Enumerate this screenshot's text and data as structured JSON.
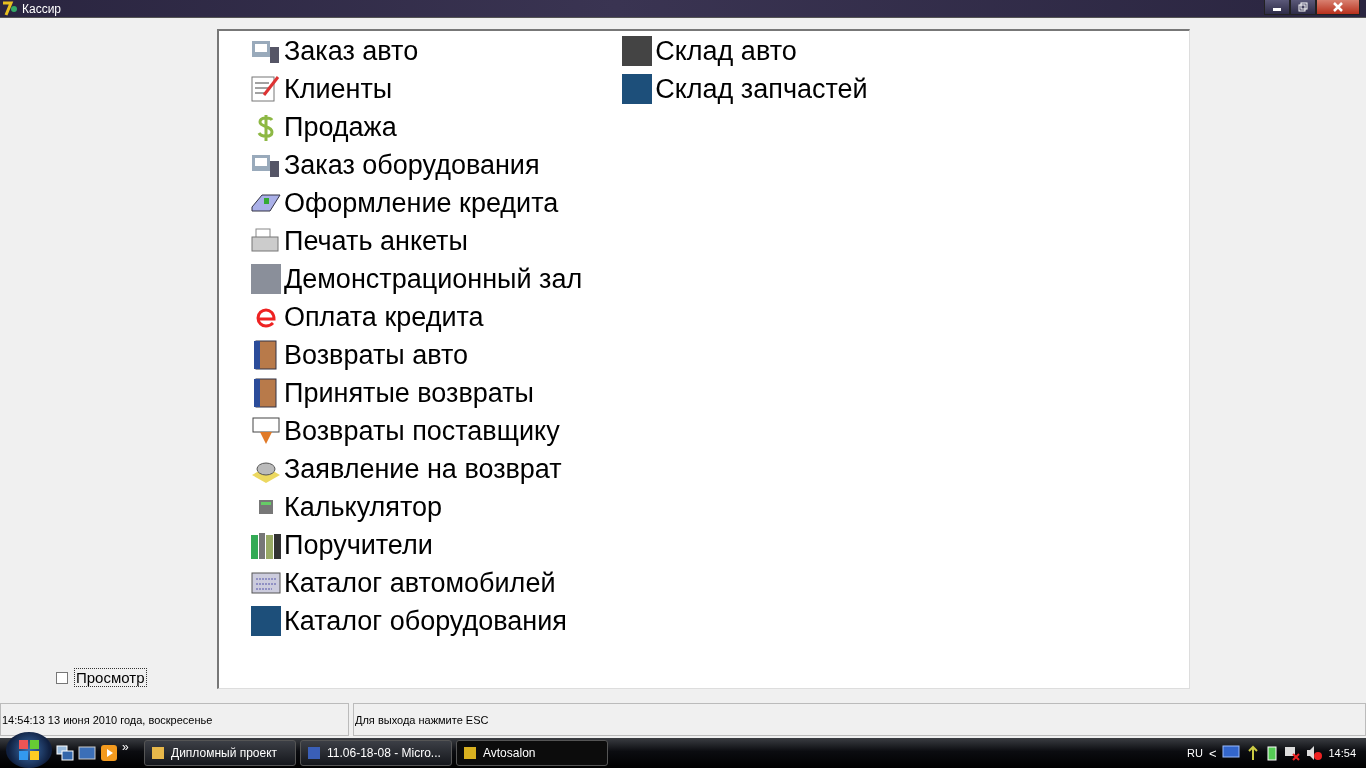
{
  "window": {
    "title": "Кассир"
  },
  "menu": {
    "columns": [
      [
        {
          "label": "Заказ авто"
        },
        {
          "label": "Клиенты"
        },
        {
          "label": "Продажа"
        },
        {
          "label": "Заказ оборудования"
        },
        {
          "label": "Оформление кредита"
        },
        {
          "label": "Печать анкеты"
        },
        {
          "label": "Демонстрационный зал"
        },
        {
          "label": "Оплата кредита"
        },
        {
          "label": "Возвраты авто"
        },
        {
          "label": "Принятые возвраты"
        },
        {
          "label": "Возвраты поставщику"
        },
        {
          "label": "Заявление на возврат"
        },
        {
          "label": "Калькулятор"
        },
        {
          "label": "Поручители"
        },
        {
          "label": "Каталог автомобилей"
        },
        {
          "label": "Каталог оборудования"
        }
      ],
      [
        {
          "label": "Склад авто"
        },
        {
          "label": "Склад запчастей"
        }
      ]
    ]
  },
  "preview_checkbox": {
    "label": "Просмотр",
    "checked": false
  },
  "status_bar": {
    "datetime": "14:54:13  13 июня 2010 года, воскресенье",
    "hint": "Для выхода нажмите ESC"
  },
  "taskbar": {
    "more": "»",
    "tasks": [
      {
        "label": "Дипломный проект",
        "selected": false
      },
      {
        "label": "11.06-18-08 - Micro...",
        "selected": false
      },
      {
        "label": "Avtosalon",
        "selected": true
      }
    ],
    "language": "RU",
    "tray_toggle": "<",
    "clock": "14:54"
  }
}
